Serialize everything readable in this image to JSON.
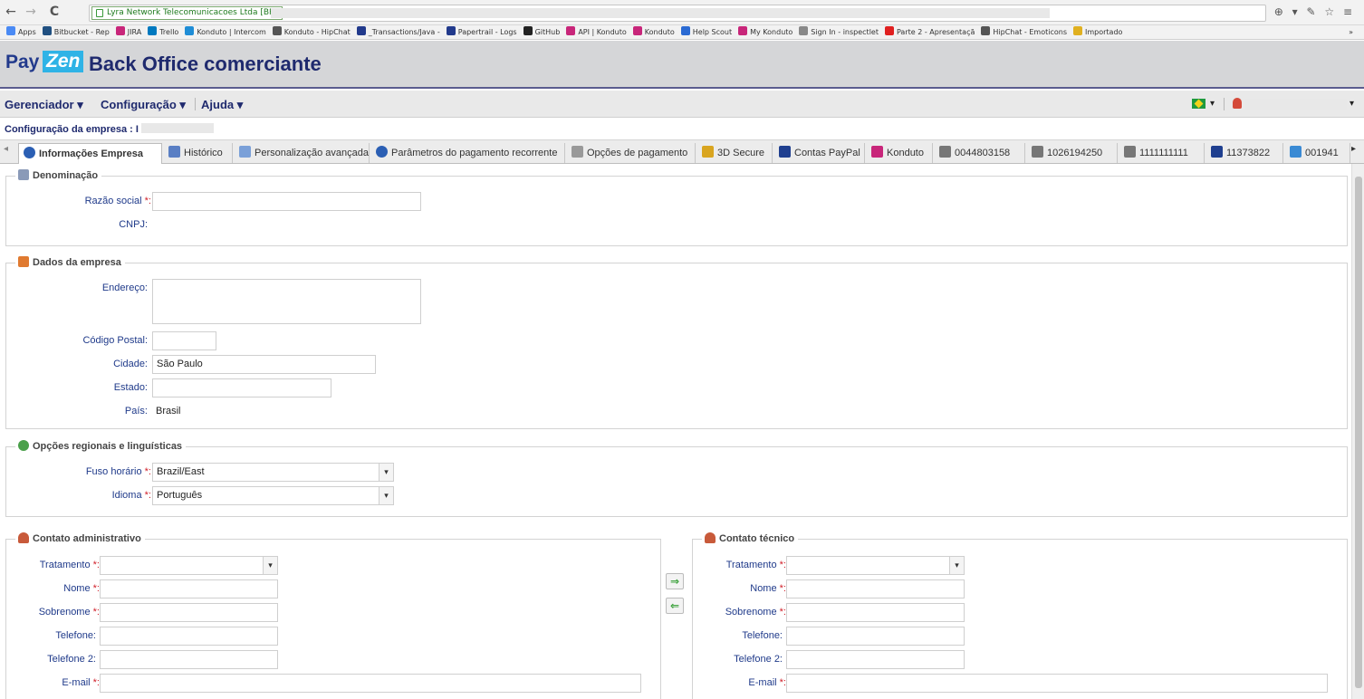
{
  "browser": {
    "back": "←",
    "forward": "→",
    "reload": "C",
    "site_badge": "Lyra Network Telecomunicacoes Ltda [BR]",
    "ext_icons": "⊕ ▾ ✎ ☆ ≡",
    "bookmarks": [
      {
        "label": "Apps",
        "color": "#4a8af4"
      },
      {
        "label": "Bitbucket - Rep",
        "color": "#205081"
      },
      {
        "label": "JIRA",
        "color": "#c8267a"
      },
      {
        "label": "Trello",
        "color": "#0079bf"
      },
      {
        "label": "Konduto | Intercom",
        "color": "#1f8dd6"
      },
      {
        "label": "Konduto - HipChat",
        "color": "#555555"
      },
      {
        "label": "_Transactions/Java -",
        "color": "#223a8c"
      },
      {
        "label": "Papertrail - Logs",
        "color": "#223a8c"
      },
      {
        "label": "GitHub",
        "color": "#222222"
      },
      {
        "label": "API | Konduto",
        "color": "#c8267a"
      },
      {
        "label": "Konduto",
        "color": "#c8267a"
      },
      {
        "label": "Help Scout",
        "color": "#2a6ad3"
      },
      {
        "label": "My Konduto",
        "color": "#c8267a"
      },
      {
        "label": "Sign In - inspectlet",
        "color": "#888888"
      },
      {
        "label": "Parte 2 - Apresentaçã",
        "color": "#e02020"
      },
      {
        "label": "HipChat - Emoticons",
        "color": "#555555"
      },
      {
        "label": "Importado",
        "color": "#e0b020"
      }
    ],
    "more_bookmarks": "»"
  },
  "header": {
    "logo_pay": "Pay",
    "logo_zen": "Zen",
    "title": "Back Office comerciante"
  },
  "menu": {
    "gerenciador": "Gerenciador ▾",
    "configuracao": "Configuração ▾",
    "ajuda": "Ajuda ▾",
    "lang_caret": "▾",
    "user_caret": "▾"
  },
  "company_label": "Configuração da empresa : I",
  "tabs": [
    {
      "label": "Informações Empresa",
      "icon": "info-icon",
      "color": "#2b5fb4"
    },
    {
      "label": "Histórico",
      "icon": "history-icon",
      "color": "#5a7fc4"
    },
    {
      "label": "Personalização avançada",
      "icon": "customize-icon",
      "color": "#7aa0d8"
    },
    {
      "label": "Parâmetros do pagamento recorrente",
      "icon": "info-icon",
      "color": "#2b5fb4"
    },
    {
      "label": "Opções de pagamento",
      "icon": "payment-options-icon",
      "color": "#999999"
    },
    {
      "label": "3D Secure",
      "icon": "3d-secure-icon",
      "color": "#d9a520"
    },
    {
      "label": "Contas PayPal",
      "icon": "paypal-icon",
      "color": "#1f3f8f"
    },
    {
      "label": "Konduto",
      "icon": "konduto-icon",
      "color": "#c8267a"
    },
    {
      "label": "0044803158",
      "icon": "cielo-icon",
      "color": "#777777"
    },
    {
      "label": "1026194250",
      "icon": "cielo-icon",
      "color": "#777777"
    },
    {
      "label": "1111111111",
      "icon": "cielo-icon",
      "color": "#777777"
    },
    {
      "label": "11373822",
      "icon": "acquirer-icon",
      "color": "#1f3f8f"
    },
    {
      "label": "001941",
      "icon": "acquirer-icon",
      "color": "#3a8ad4"
    }
  ],
  "sections": {
    "denominacao": {
      "legend": "Denominação",
      "razao_label": "Razão social",
      "razao_value": "",
      "cnpj_label": "CNPJ:",
      "cnpj_value": ""
    },
    "dados": {
      "legend": "Dados da empresa",
      "endereco_label": "Endereço:",
      "endereco_value": "",
      "cep_label": "Código Postal:",
      "cep_value": "",
      "cidade_label": "Cidade:",
      "cidade_value": "São Paulo",
      "estado_label": "Estado:",
      "estado_value": "",
      "pais_label": "País:",
      "pais_value": "Brasil"
    },
    "regional": {
      "legend": "Opções regionais e linguísticas",
      "fuso_label": "Fuso horário",
      "fuso_value": "Brazil/East",
      "idioma_label": "Idioma",
      "idioma_value": "Português"
    },
    "admin": {
      "legend": "Contato administrativo",
      "tratamento_label": "Tratamento",
      "nome_label": "Nome",
      "sobrenome_label": "Sobrenome",
      "telefone_label": "Telefone:",
      "telefone2_label": "Telefone 2:",
      "email_label": "E-mail"
    },
    "tecnico": {
      "legend": "Contato técnico",
      "tratamento_label": "Tratamento",
      "nome_label": "Nome",
      "sobrenome_label": "Sobrenome",
      "telefone_label": "Telefone:",
      "telefone2_label": "Telefone 2:",
      "email_label": "E-mail"
    }
  },
  "copy_buttons": {
    "to_right": "⇒",
    "to_left": "⇐"
  },
  "required_suffix": "*:",
  "select_arrow": "▾"
}
